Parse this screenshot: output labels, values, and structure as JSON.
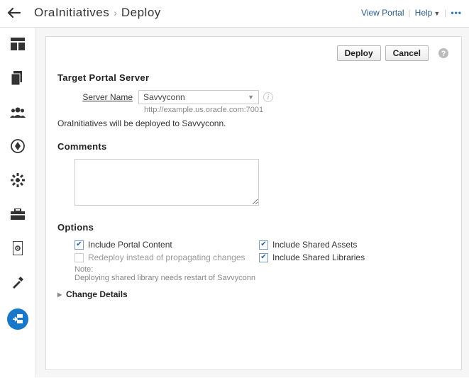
{
  "header": {
    "breadcrumb": [
      "OraInitiatives",
      "Deploy"
    ],
    "links": {
      "view_portal": "View Portal",
      "help": "Help"
    }
  },
  "sidebar": {
    "items": [
      {
        "name": "dashboard-icon"
      },
      {
        "name": "templates-icon"
      },
      {
        "name": "users-icon"
      },
      {
        "name": "directions-icon"
      },
      {
        "name": "settings-icon"
      },
      {
        "name": "toolbox-icon"
      },
      {
        "name": "mobile-icon"
      },
      {
        "name": "tools-icon"
      },
      {
        "name": "deploy-icon"
      }
    ]
  },
  "actions": {
    "deploy": "Deploy",
    "cancel": "Cancel"
  },
  "target_server": {
    "section_title": "Target Portal Server",
    "label": "Server Name",
    "selected": "Savvyconn",
    "url": "http://example.us.oracle.com:7001",
    "note": "OraInitiatives will be deployed to Savvyconn."
  },
  "comments": {
    "section_title": "Comments",
    "value": ""
  },
  "options": {
    "section_title": "Options",
    "include_portal_content": {
      "label": "Include Portal Content",
      "checked": true,
      "disabled": false
    },
    "include_shared_assets": {
      "label": "Include Shared Assets",
      "checked": true,
      "disabled": false
    },
    "redeploy": {
      "label": "Redeploy instead of propagating changes",
      "checked": false,
      "disabled": true
    },
    "include_shared_libraries": {
      "label": "Include Shared Libraries",
      "checked": true,
      "disabled": false
    },
    "note_label": "Note:",
    "note_text": "Deploying shared library needs restart of Savvyconn"
  },
  "change_details": {
    "label": "Change Details"
  }
}
